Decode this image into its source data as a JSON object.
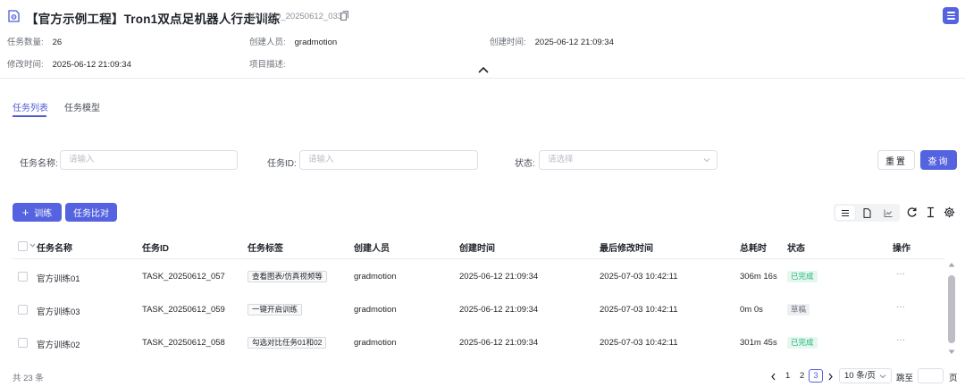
{
  "header": {
    "title": "【官方示例工程】Tron1双点足机器人行走训练",
    "project_id": "ID: PRO_20250612_033",
    "meta": [
      {
        "key": "任务数量:",
        "value": "26"
      },
      {
        "key": "创建人员:",
        "value": "gradmotion"
      },
      {
        "key": "创建时间:",
        "value": "2025-06-12 21:09:34"
      },
      {
        "key": "修改时间:",
        "value": "2025-06-12 21:09:34"
      },
      {
        "key": "项目描述:",
        "value": ""
      }
    ],
    "accent_color": "#5563e0"
  },
  "tabs": [
    {
      "label": "任务列表",
      "active": true
    },
    {
      "label": "任务模型",
      "active": false
    }
  ],
  "filters": {
    "name_label": "任务名称:",
    "name_placeholder": "请输入",
    "id_label": "任务ID:",
    "id_placeholder": "请输入",
    "status_label": "状态:",
    "status_placeholder": "请选择",
    "reset_label": "重置",
    "query_label": "查询"
  },
  "actions": {
    "train_label": "训练",
    "compare_label": "任务比对"
  },
  "view_modes": [
    "list-view-icon",
    "document-view-icon",
    "chart-view-icon"
  ],
  "table": {
    "columns": [
      "任务名称",
      "任务ID",
      "任务标签",
      "创建人员",
      "创建时间",
      "最后修改时间",
      "总耗时",
      "状态",
      "操作"
    ],
    "rows": [
      {
        "name": "官方训练01",
        "id": "TASK_20250612_057",
        "tag": "查看图表/仿真视频等",
        "creator": "gradmotion",
        "created": "2025-06-12 21:09:34",
        "modified": "2025-07-03 10:42:11",
        "duration": "306m 16s",
        "status": "已完成",
        "status_kind": "done",
        "action": "···"
      },
      {
        "name": "官方训练03",
        "id": "TASK_20250612_059",
        "tag": "一键开启训练",
        "creator": "gradmotion",
        "created": "2025-06-12 21:09:34",
        "modified": "2025-07-03 10:42:11",
        "duration": "0m 0s",
        "status": "草稿",
        "status_kind": "draft",
        "action": "···"
      },
      {
        "name": "官方训练02",
        "id": "TASK_20250612_058",
        "tag": "勾选对比任务01和02",
        "creator": "gradmotion",
        "created": "2025-06-12 21:09:34",
        "modified": "2025-07-03 10:42:11",
        "duration": "301m 45s",
        "status": "已完成",
        "status_kind": "done",
        "action": "···"
      }
    ]
  },
  "pagination": {
    "total": "共 23 条",
    "pages": [
      "1",
      "2",
      "3"
    ],
    "current": "3",
    "page_size": "10 条/页",
    "jump_label": "跳至",
    "page_suffix": "页"
  }
}
